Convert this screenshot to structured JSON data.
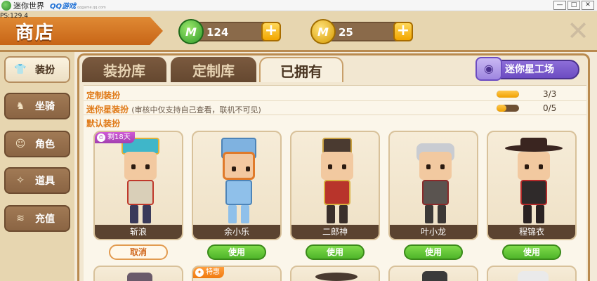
{
  "window": {
    "title": "迷你世界",
    "qq_logo": "QQ游戏",
    "qq_sub": "qqgame.qq.com",
    "min": "—",
    "max": "□",
    "close": "✕"
  },
  "fps": "PS:129.4",
  "header": {
    "shop_title": "商店",
    "mini_beans": "124",
    "mini_coins": "25",
    "bean_glyph": "M",
    "coin_glyph": "M",
    "plus": "+",
    "close": "✕"
  },
  "sidebar": {
    "items": [
      {
        "label": "装扮",
        "icon": "shirt-icon",
        "glyph": "👕",
        "active": true
      },
      {
        "label": "坐骑",
        "icon": "mount-icon",
        "glyph": "♞",
        "active": false
      },
      {
        "label": "角色",
        "icon": "character-icon",
        "glyph": "☺",
        "active": false
      },
      {
        "label": "道具",
        "icon": "item-icon",
        "glyph": "✧",
        "active": false
      },
      {
        "label": "充值",
        "icon": "coins-icon",
        "glyph": "≋",
        "active": false
      }
    ]
  },
  "tabs": [
    {
      "label": "装扮库",
      "active": false
    },
    {
      "label": "定制库",
      "active": false
    },
    {
      "label": "已拥有",
      "active": true
    }
  ],
  "workshop_button": "迷你星工场",
  "sections": [
    {
      "label": "定制装扮",
      "note": "",
      "count": "3/3",
      "progress": 1.0
    },
    {
      "label": "迷你星装扮",
      "note": "(审核中仅支持自己查看，联机不可见)",
      "count": "0/5",
      "progress": 0.0
    },
    {
      "label": "默认装扮",
      "note": ""
    }
  ],
  "cards": [
    {
      "name": "斩浪",
      "badge": "剩18天",
      "button": "取消",
      "button_type": "cancel"
    },
    {
      "name": "余小乐",
      "badge": "",
      "button": "使用",
      "button_type": "use"
    },
    {
      "name": "二郎神",
      "badge": "",
      "button": "使用",
      "button_type": "use"
    },
    {
      "name": "叶小龙",
      "badge": "",
      "button": "使用",
      "button_type": "use"
    },
    {
      "name": "程锦衣",
      "badge": "",
      "button": "使用",
      "button_type": "use"
    }
  ],
  "next_row_badge": "特惠",
  "colors": {
    "accent_orange": "#e07a18",
    "use_green": "#4fb52a",
    "workshop_purple": "#6c4cc2",
    "badge_purple": "#a23fb0"
  }
}
